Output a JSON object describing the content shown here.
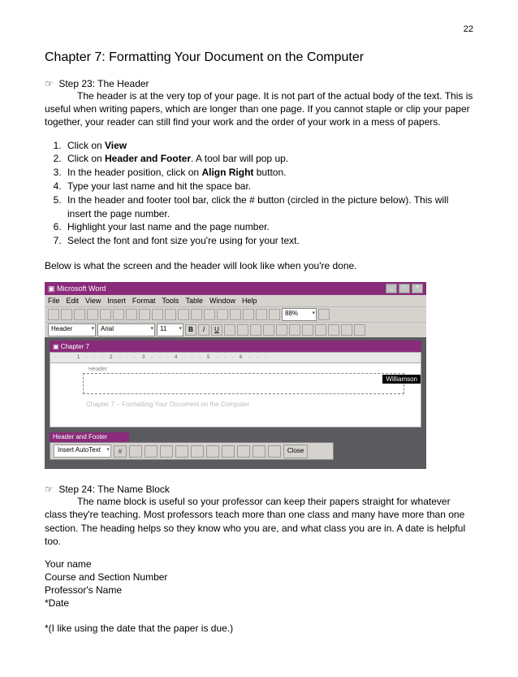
{
  "page_number": "22",
  "chapter_title": "Chapter 7: Formatting Your Document on the Computer",
  "step23": {
    "heading": "Step 23: The Header",
    "intro": "The header is at the very top of your page. It is not part of the actual body of the text. This is useful when writing papers, which are longer than one page. If you cannot staple or clip your paper together, your reader can still find your work and the order of your work in a mess of papers.",
    "steps": {
      "1a": "Click on ",
      "1b": "View",
      "2a": "Click on ",
      "2b": "Header and Footer",
      "2c": ". A tool bar will pop up.",
      "3a": "In the header position, click on ",
      "3b": "Align Right",
      "3c": " button.",
      "4": "Type your last name and hit the space bar.",
      "5": "In the header and footer tool bar, click the # button (circled in the picture below). This will insert the page number.",
      "6": "Highlight your last name and the page number.",
      "7": "Select the font and font size you're using for your text."
    },
    "below_text": "Below is what the screen and the header will look like when you're done."
  },
  "figure": {
    "app_title": "Microsoft Word",
    "menu": {
      "file": "File",
      "edit": "Edit",
      "view": "View",
      "insert": "Insert",
      "format": "Format",
      "tools": "Tools",
      "table": "Table",
      "window": "Window",
      "help": "Help"
    },
    "style_sel": "Header",
    "font_sel": "Arial",
    "size_sel": "11",
    "zoom_sel": "88%",
    "doc_title": "Chapter 7",
    "header_label": "Header",
    "header_name": "Williamson",
    "ghost": "Chapter 7 – Formatting Your Document on the Computer",
    "hf_title": "Header and Footer",
    "hf_autotext": "Insert AutoText",
    "hf_close": "Close"
  },
  "step24": {
    "heading": "Step 24: The Name Block",
    "intro": "The name block is useful so your professor can keep their papers straight for whatever class they're teaching. Most professors teach more than one class and many have more than one section. The heading helps so they know who you are, and what class you are in. A date is helpful too.",
    "lines": {
      "l1": "Your name",
      "l2": "Course and Section Number",
      "l3": "Professor's Name",
      "l4": "*Date"
    },
    "note": "*(I like using the date that the paper is due.)"
  }
}
